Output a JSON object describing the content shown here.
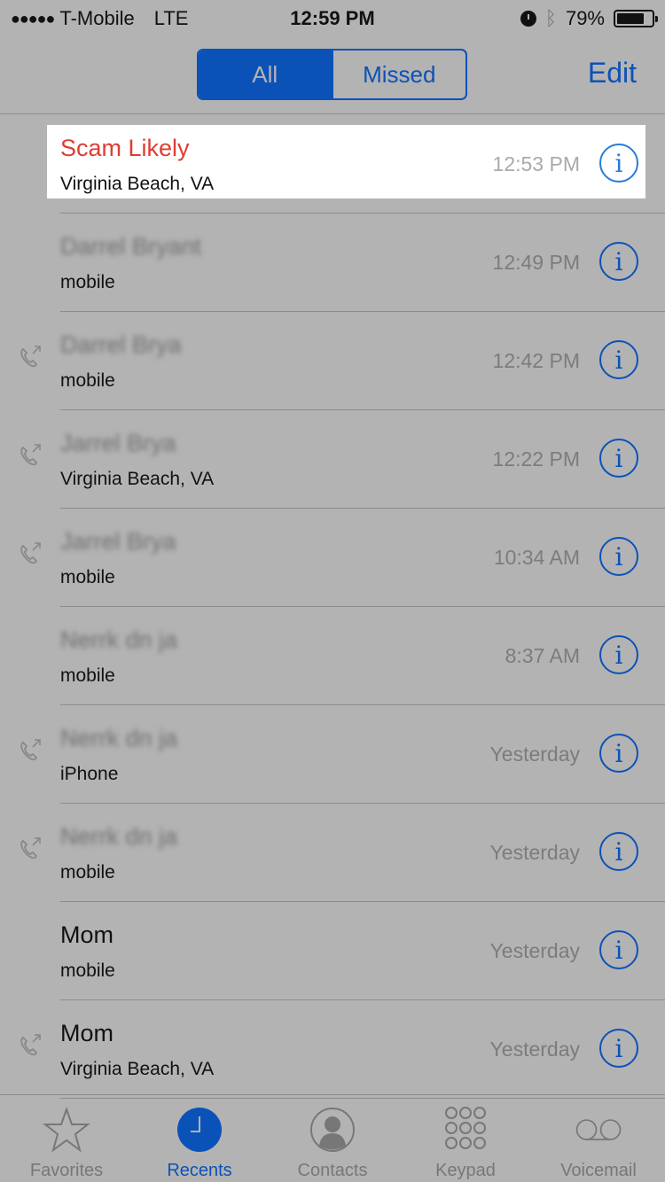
{
  "status_bar": {
    "signal": "●●●●●",
    "carrier": "T-Mobile",
    "network": "LTE",
    "time": "12:59 PM",
    "battery_percent": "79%",
    "battery_level": 0.79
  },
  "nav": {
    "segments": [
      {
        "label": "All",
        "active": true
      },
      {
        "label": "Missed",
        "active": false
      }
    ],
    "edit_label": "Edit"
  },
  "calls": [
    {
      "name": "Scam Likely",
      "subtitle": "Virginia Beach, VA",
      "time": "12:53 PM",
      "outgoing": false,
      "style": "red",
      "highlighted": true
    },
    {
      "name": "Darrel Bryant",
      "subtitle": "mobile",
      "time": "12:49 PM",
      "outgoing": false,
      "style": "blurred"
    },
    {
      "name": "Darrel Brya",
      "subtitle": "mobile",
      "time": "12:42 PM",
      "outgoing": true,
      "style": "blurred"
    },
    {
      "name": "Jarrel Brya",
      "subtitle": "Virginia Beach, VA",
      "time": "12:22 PM",
      "outgoing": true,
      "style": "blurred"
    },
    {
      "name": "Jarrel Brya",
      "subtitle": "mobile",
      "time": "10:34 AM",
      "outgoing": true,
      "style": "blurred"
    },
    {
      "name": "Nerrk dn ja",
      "subtitle": "mobile",
      "time": "8:37 AM",
      "outgoing": false,
      "style": "blurred"
    },
    {
      "name": "Nerrk dn ja",
      "subtitle": "iPhone",
      "time": "Yesterday",
      "outgoing": true,
      "style": "blurred"
    },
    {
      "name": "Nerrk dn ja",
      "subtitle": "mobile",
      "time": "Yesterday",
      "outgoing": true,
      "style": "blurred"
    },
    {
      "name": "Mom",
      "subtitle": "mobile",
      "time": "Yesterday",
      "outgoing": false,
      "style": "normal"
    },
    {
      "name": "Mom",
      "subtitle": "Virginia Beach, VA",
      "time": "Yesterday",
      "outgoing": true,
      "style": "normal"
    }
  ],
  "info_icon_glyph": "i",
  "tabs": [
    {
      "label": "Favorites",
      "icon": "star-icon",
      "active": false
    },
    {
      "label": "Recents",
      "icon": "clock-icon",
      "active": true
    },
    {
      "label": "Contacts",
      "icon": "person-icon",
      "active": false
    },
    {
      "label": "Keypad",
      "icon": "keypad-icon",
      "active": false
    },
    {
      "label": "Voicemail",
      "icon": "voicemail-icon",
      "active": false
    }
  ],
  "colors": {
    "accent": "#0b52b8",
    "scam_red": "#e03c31",
    "background_dimmed": "#b3b3b3"
  }
}
